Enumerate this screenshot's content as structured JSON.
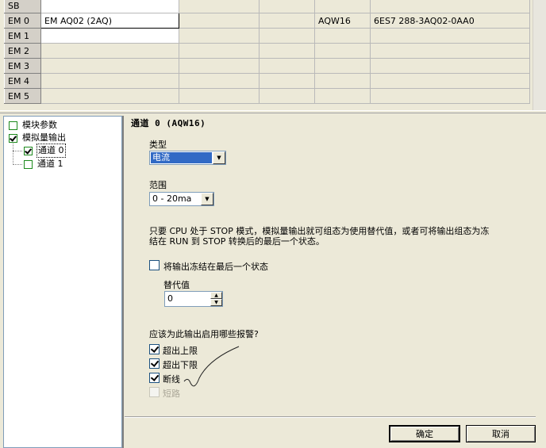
{
  "module_table": {
    "rows": [
      {
        "slot": "SB",
        "module": "",
        "input": "",
        "output": "",
        "addr": "",
        "order": ""
      },
      {
        "slot": "EM 0",
        "module": "EM AQ02 (2AQ)",
        "input": "",
        "output": "",
        "addr": "AQW16",
        "order": "6ES7 288-3AQ02-0AA0"
      },
      {
        "slot": "EM 1",
        "module": "",
        "input": "",
        "output": "",
        "addr": "",
        "order": ""
      },
      {
        "slot": "EM 2",
        "module": "",
        "input": "",
        "output": "",
        "addr": "",
        "order": ""
      },
      {
        "slot": "EM 3",
        "module": "",
        "input": "",
        "output": "",
        "addr": "",
        "order": ""
      },
      {
        "slot": "EM 4",
        "module": "",
        "input": "",
        "output": "",
        "addr": "",
        "order": ""
      },
      {
        "slot": "EM 5",
        "module": "",
        "input": "",
        "output": "",
        "addr": "",
        "order": ""
      }
    ]
  },
  "tree": {
    "items": [
      {
        "label": "模块参数",
        "checked": false
      },
      {
        "label": "模拟量输出",
        "checked": true
      },
      {
        "label": "通道 0",
        "checked": true
      },
      {
        "label": "通道 1",
        "checked": false
      }
    ]
  },
  "panel": {
    "title": "通道 0 (AQW16)",
    "type_label": "类型",
    "type_value": "电流",
    "range_label": "范围",
    "range_value": "0 - 20ma",
    "description_line1": "只要 CPU 处于 STOP 模式，模拟量输出就可组态为使用替代值，或者可将输出组态为冻",
    "description_line2": "结在 RUN 到 STOP 转换后的最后一个状态。",
    "freeze_label": "将输出冻结在最后一个状态",
    "freeze_checked": false,
    "substitute_label": "替代值",
    "substitute_value": "0",
    "alarms_question": "应该为此输出启用哪些报警?",
    "alarms": [
      {
        "label": "超出上限",
        "checked": true,
        "enabled": true
      },
      {
        "label": "超出下限",
        "checked": true,
        "enabled": true
      },
      {
        "label": "断线",
        "checked": true,
        "enabled": true
      },
      {
        "label": "短路",
        "checked": false,
        "enabled": false
      }
    ]
  },
  "buttons": {
    "ok": "确定",
    "cancel": "取消"
  }
}
